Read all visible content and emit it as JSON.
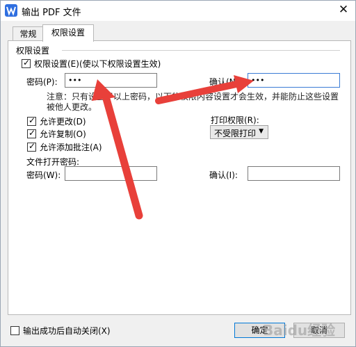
{
  "window": {
    "title": "输出 PDF 文件",
    "close_glyph": "✕"
  },
  "tabs": [
    {
      "label": "常规"
    },
    {
      "label": "权限设置"
    }
  ],
  "permissions": {
    "group_label": "权限设置",
    "enable_checkbox": {
      "label": "权限设置(E)(使以下权限设置生效)",
      "checked": true
    },
    "password": {
      "label": "密码(P):",
      "value": "***"
    },
    "confirm": {
      "label": "确认(N):",
      "value": "***"
    },
    "note": "注意：只有设置了以上密码，以下的权限内容设置才会生效，并能防止这些设置被他人更改。",
    "options": [
      {
        "label": "允许更改(D)",
        "checked": true
      },
      {
        "label": "允许复制(O)",
        "checked": true
      },
      {
        "label": "允许添加批注(A)",
        "checked": true
      }
    ],
    "print": {
      "label": "打印权限(R):",
      "selected": "不受限打印"
    }
  },
  "open_password": {
    "section_label": "文件打开密码:",
    "password": {
      "label": "密码(W):",
      "value": ""
    },
    "confirm": {
      "label": "确认(I):",
      "value": ""
    }
  },
  "footer": {
    "auto_close": {
      "label": "输出成功后自动关闭(X)",
      "checked": false
    },
    "ok_label": "确定",
    "cancel_label": "取消"
  },
  "watermark": "Baidu经验",
  "colors": {
    "arrow": "#e8403a",
    "focus": "#3a7bd5",
    "accent": "#0078d7"
  }
}
